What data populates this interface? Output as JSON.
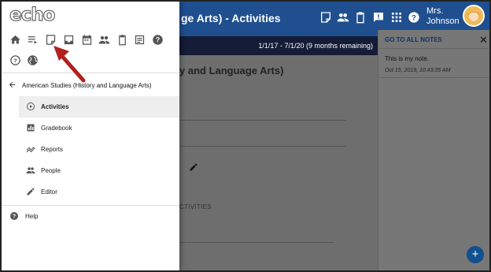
{
  "header": {
    "title": "ge Arts) - Activities",
    "user_line1": "Mrs.",
    "user_line2": "Johnson",
    "icons": [
      "note-icon",
      "people-icon",
      "clipboard-icon",
      "feedback-icon",
      "apps-grid-icon",
      "help-icon"
    ]
  },
  "date_range": "1/1/17 - 7/1/20 (9 months remaining)",
  "main": {
    "heading": "y and Language Arts)",
    "tab_label": "CTIVITIES"
  },
  "notes": {
    "go_label": "GO TO ALL NOTES",
    "close": "✕",
    "note_text": "This is my note.",
    "timestamp": "Oct 15, 2019, 10:43:35 AM",
    "add": "+"
  },
  "drawer": {
    "logo": "echo",
    "toolbar_icons": [
      "home-icon",
      "playlist-icon",
      "note-icon",
      "inbox-icon",
      "calendar-icon",
      "people-icon",
      "clipboard-icon",
      "list-icon",
      "help-icon",
      "question-circle-icon",
      "globe-icon"
    ],
    "course_title": "American Studies (History and Language Arts)",
    "nav": [
      {
        "label": "Activities",
        "icon": "play-circle-icon",
        "active": true
      },
      {
        "label": "Gradebook",
        "icon": "bar-chart-icon",
        "active": false
      },
      {
        "label": "Reports",
        "icon": "trend-icon",
        "active": false
      },
      {
        "label": "People",
        "icon": "people-icon",
        "active": false
      },
      {
        "label": "Editor",
        "icon": "pencil-icon",
        "active": false
      }
    ],
    "help_label": "Help"
  },
  "colors": {
    "header_blue": "#1f4f8f",
    "accent_red": "#c0392b",
    "fab_blue": "#12508f"
  }
}
